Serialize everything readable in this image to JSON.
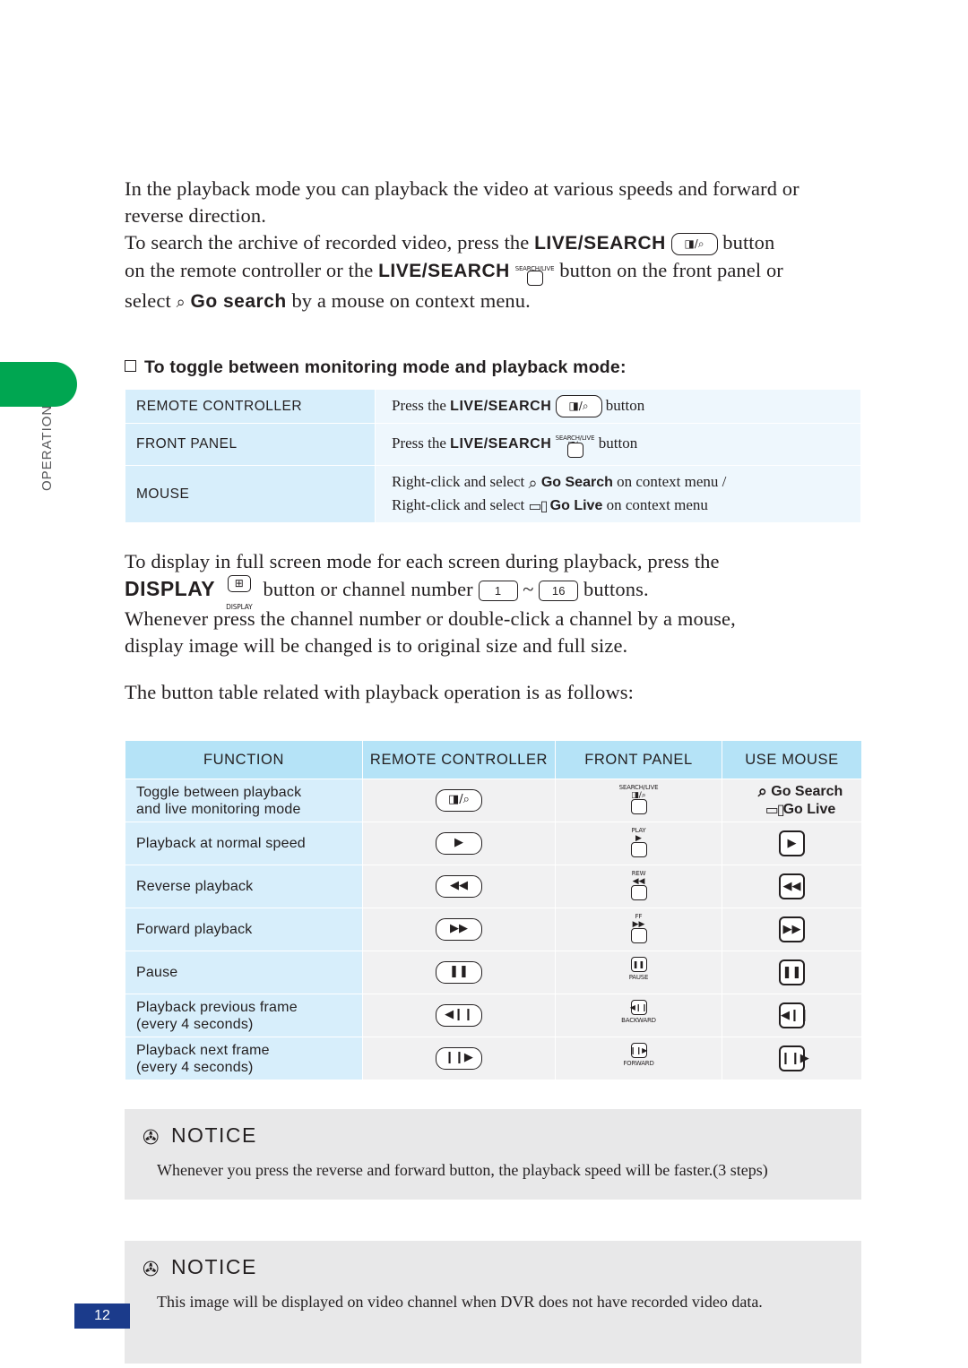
{
  "side": {
    "label": "OPERATION"
  },
  "intro": {
    "line1": "In the playback mode you can playback the video at various speeds and forward or reverse direction.",
    "line2a": "To search the archive of recorded video, press the",
    "livesearch": "LIVE/SEARCH",
    "line2b": "button",
    "line3a": "on the remote controller or the",
    "line3b": "button on the front panel or",
    "line4a": "select",
    "line4b": "Go search",
    "line4c": "by a mouse on context menu."
  },
  "subheading": "To toggle between monitoring mode and playback mode:",
  "toggle_table": {
    "rows": [
      {
        "label": "REMOTE CONTROLLER",
        "pre": "Press the",
        "bold": "LIVE/SEARCH",
        "post": "button",
        "key": "remote"
      },
      {
        "label": "FRONT PANEL",
        "pre": "Press the",
        "bold": "LIVE/SEARCH",
        "post": "button",
        "key": "panel"
      },
      {
        "label": "MOUSE",
        "line1a": "Right-click and select",
        "line1b": "Go Search",
        "line1c": "on context menu /",
        "line2a": "Right-click and select",
        "line2b": "Go Live",
        "line2c": "on context menu"
      }
    ]
  },
  "mid": {
    "line1": "To display in full screen mode for each screen during playback, press the",
    "display": "DISPLAY",
    "display_cap": "DISPLAY",
    "line2a": "button or channel number",
    "ch_first": "1",
    "ch_tilde": "~",
    "ch_last": "16",
    "line2b": "buttons.",
    "line3": "Whenever press the channel number or double-click a channel by a mouse,",
    "line4": "display image will be changed is to original size and full size.",
    "line5": "The button table related with playback operation is as follows:"
  },
  "button_table": {
    "headers": [
      "FUNCTION",
      "REMOTE CONTROLLER",
      "FRONT PANEL",
      "USE MOUSE"
    ],
    "rows": [
      {
        "function": "Toggle between playback\nand live monitoring mode",
        "remote": "live-search",
        "panel_cap": "SEARCH/LIVE",
        "panel_glyph": "live-search",
        "panel_cap_bottom": "",
        "mouse_kind": "text",
        "mouse_line1": "Go Search",
        "mouse_line2": "Go Live"
      },
      {
        "function": "Playback at normal speed",
        "remote": "play",
        "panel_cap": "PLAY",
        "panel_glyph": "play",
        "panel_cap_bottom": "",
        "mouse_kind": "key",
        "mouse_glyph": "play"
      },
      {
        "function": "Reverse playback",
        "remote": "rewind",
        "panel_cap": "REW",
        "panel_glyph": "rewind",
        "panel_cap_bottom": "",
        "mouse_kind": "key",
        "mouse_glyph": "rewind"
      },
      {
        "function": "Forward playback",
        "remote": "forward",
        "panel_cap": "FF",
        "panel_glyph": "forward",
        "panel_cap_bottom": "",
        "mouse_kind": "key",
        "mouse_glyph": "forward"
      },
      {
        "function": "Pause",
        "remote": "pause",
        "panel_cap": "",
        "panel_glyph": "pause",
        "panel_cap_bottom": "PAUSE",
        "mouse_kind": "key",
        "mouse_glyph": "pause"
      },
      {
        "function": "Playback previous frame\n(every 4 seconds)",
        "remote": "step-back",
        "panel_cap": "",
        "panel_glyph": "step-back",
        "panel_cap_bottom": "BACKWARD",
        "mouse_kind": "key",
        "mouse_glyph": "step-back"
      },
      {
        "function": "Playback next frame\n(every 4 seconds)",
        "remote": "step-forward",
        "panel_cap": "",
        "panel_glyph": "step-forward",
        "panel_cap_bottom": "FORWARD",
        "mouse_kind": "key",
        "mouse_glyph": "step-forward"
      }
    ]
  },
  "notices": [
    {
      "title": "NOTICE",
      "body": "Whenever you press the reverse and forward button, the playback speed will be faster.(3 steps)"
    },
    {
      "title": "NOTICE",
      "body": "This image will be displayed on video channel when DVR does not have recorded video data."
    }
  ],
  "page_number": "12",
  "colors": {
    "green_tab": "#00a651",
    "table_header": "#b5e3f7",
    "label_cell": "#d7eefb",
    "value_cell": "#eef7fd",
    "data_cell": "#f1f1f2",
    "notice_bg": "#e8e8e9",
    "page_badge": "#1b3b8b"
  }
}
